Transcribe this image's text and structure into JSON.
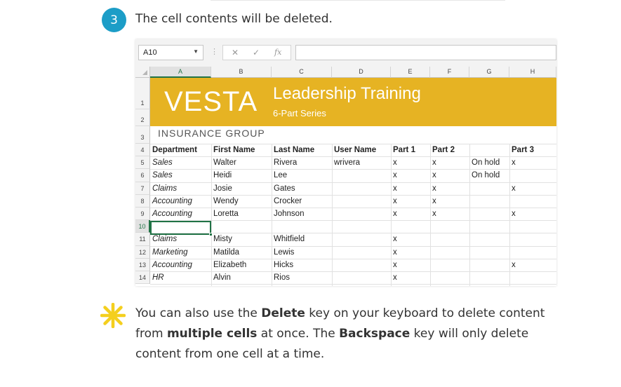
{
  "step": {
    "number": "3",
    "text": "The cell contents will be deleted."
  },
  "spreadsheet": {
    "name_box": "A10",
    "formula_buttons": {
      "cancel": "✕",
      "enter": "✓",
      "function": "fx"
    },
    "formula_value": "",
    "columns": [
      "A",
      "B",
      "C",
      "D",
      "E",
      "F",
      "G",
      "H"
    ],
    "selected_column": "A",
    "selected_row": "10",
    "banner": {
      "logo": "VESTA",
      "title": "Leadership Training",
      "subtitle": "6-Part Series",
      "tagline": "INSURANCE GROUP"
    },
    "header_row": {
      "row": "4",
      "cells": [
        "Department",
        "First Name",
        "Last Name",
        "User Name",
        "Part 1",
        "Part 2",
        "",
        "Part 3"
      ]
    },
    "rows": [
      {
        "row": "5",
        "cells": [
          "Sales",
          "Walter",
          "Rivera",
          "wrivera",
          "x",
          "x",
          "On hold",
          "x"
        ]
      },
      {
        "row": "6",
        "cells": [
          "Sales",
          "Heidi",
          "Lee",
          "",
          "x",
          "x",
          "On hold",
          ""
        ]
      },
      {
        "row": "7",
        "cells": [
          "Claims",
          "Josie",
          "Gates",
          "",
          "x",
          "x",
          "",
          "x"
        ]
      },
      {
        "row": "8",
        "cells": [
          "Accounting",
          "Wendy",
          "Crocker",
          "",
          "x",
          "x",
          "",
          ""
        ]
      },
      {
        "row": "9",
        "cells": [
          "Accounting",
          "Loretta",
          "Johnson",
          "",
          "x",
          "x",
          "",
          "x"
        ]
      },
      {
        "row": "10",
        "cells": [
          "",
          "",
          "",
          "",
          "",
          "",
          "",
          ""
        ]
      },
      {
        "row": "11",
        "cells": [
          "Claims",
          "Misty",
          "Whitfield",
          "",
          "x",
          "",
          "",
          ""
        ]
      },
      {
        "row": "12",
        "cells": [
          "Marketing",
          "Matilda",
          "Lewis",
          "",
          "x",
          "",
          "",
          ""
        ]
      },
      {
        "row": "13",
        "cells": [
          "Accounting",
          "Elizabeth",
          "Hicks",
          "",
          "x",
          "",
          "",
          "x"
        ]
      },
      {
        "row": "14",
        "cells": [
          "HR",
          "Alvin",
          "Rios",
          "",
          "x",
          "",
          "",
          ""
        ]
      }
    ],
    "top_row_numbers": [
      "1",
      "2",
      "3"
    ],
    "colors": {
      "banner": "#e6b323",
      "selection": "#217346"
    }
  },
  "tip": {
    "icon": "asterisk-icon",
    "icon_color": "#f4cf1e",
    "t1": "You can also use the ",
    "b1": "Delete",
    "t2": " key on your keyboard to delete content from ",
    "b2": "multiple cells",
    "t3": " at once. The ",
    "b3": "Backspace",
    "t4": " key will only delete content from one cell at a time."
  }
}
